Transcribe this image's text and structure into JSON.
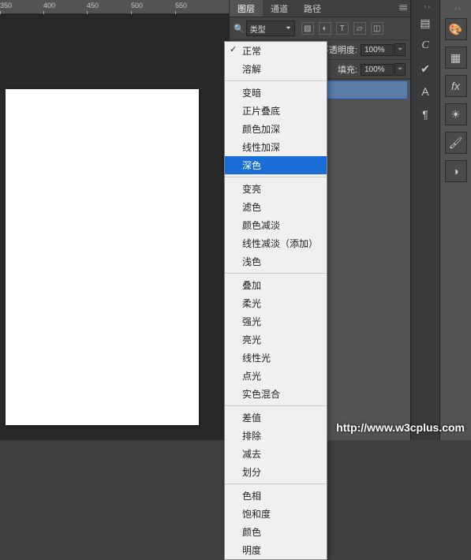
{
  "ruler_ticks": [
    "350",
    "400",
    "450",
    "500",
    "550"
  ],
  "panel": {
    "tabs": [
      "图层",
      "通道",
      "路径"
    ],
    "active_tab": 0,
    "filter_label": "类型",
    "opacity_label": "不透明度:",
    "opacity_value": "100%",
    "fill_label": "填充:",
    "fill_value": "100%"
  },
  "blend_modes": {
    "checked": "正常",
    "selected": "深色",
    "groups": [
      [
        "正常",
        "溶解"
      ],
      [
        "变暗",
        "正片叠底",
        "颜色加深",
        "线性加深",
        "深色"
      ],
      [
        "变亮",
        "滤色",
        "颜色减淡",
        "线性减淡（添加）",
        "浅色"
      ],
      [
        "叠加",
        "柔光",
        "强光",
        "亮光",
        "线性光",
        "点光",
        "实色混合"
      ],
      [
        "差值",
        "排除",
        "减去",
        "划分"
      ],
      [
        "色相",
        "饱和度",
        "颜色",
        "明度"
      ]
    ]
  },
  "tool_strip_letters": [
    "A",
    "¶"
  ],
  "watermark": "http://www.w3cplus.com"
}
